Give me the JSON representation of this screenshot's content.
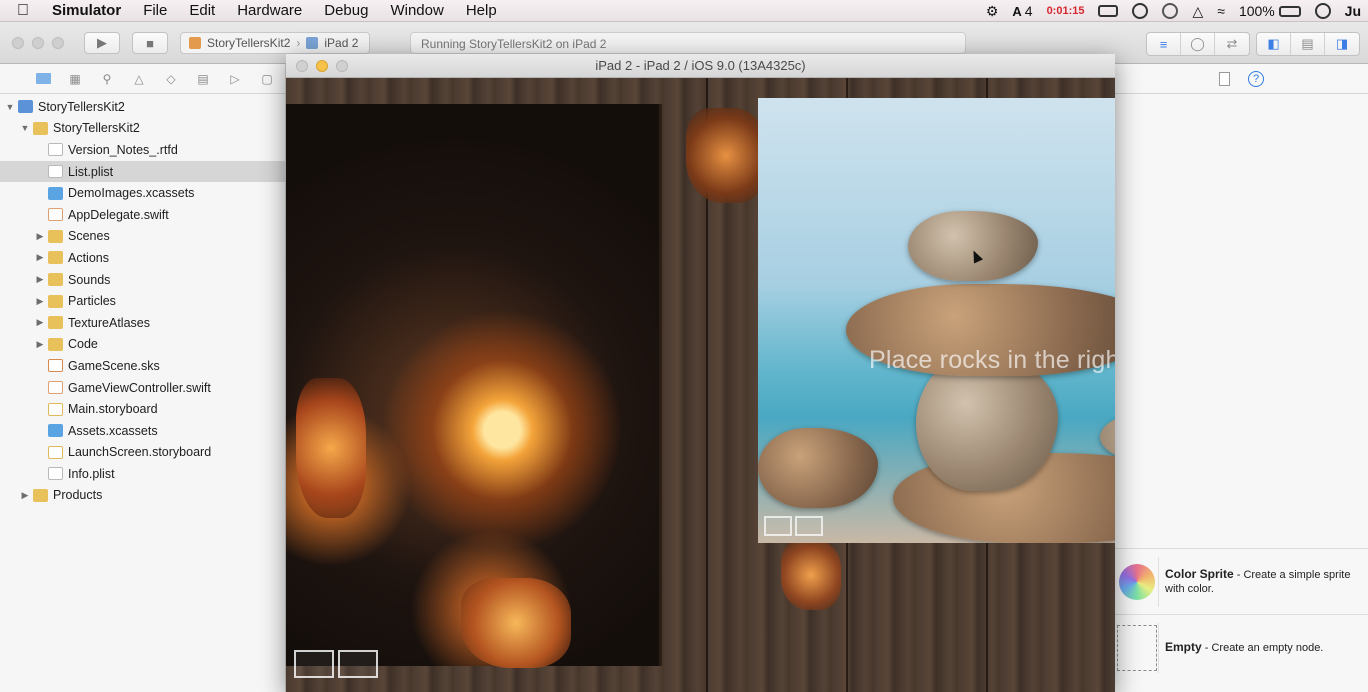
{
  "menubar": {
    "app": "Simulator",
    "items": [
      "File",
      "Edit",
      "Hardware",
      "Debug",
      "Window",
      "Help"
    ],
    "status": {
      "adobe_count": "4",
      "timer": "0:01:15",
      "battery": "100%",
      "user_initial": "Ju"
    }
  },
  "toolbar": {
    "scheme_project": "StoryTellersKit2",
    "scheme_device": "iPad 2",
    "activity": "Running StoryTellersKit2 on iPad 2"
  },
  "navigator": {
    "items": [
      {
        "label": "StoryTellersKit2",
        "icon": "project-icon",
        "indent": 0,
        "disclosure": "open"
      },
      {
        "label": "StoryTellersKit2",
        "icon": "folder-icon",
        "indent": 1,
        "disclosure": "open"
      },
      {
        "label": "Version_Notes_.rtfd",
        "icon": "document-icon",
        "indent": 2,
        "disclosure": "none"
      },
      {
        "label": "List.plist",
        "icon": "plist-icon",
        "indent": 2,
        "disclosure": "none",
        "selected": true
      },
      {
        "label": "DemoImages.xcassets",
        "icon": "asset-catalog-icon",
        "indent": 2,
        "disclosure": "none"
      },
      {
        "label": "AppDelegate.swift",
        "icon": "swift-file-icon",
        "indent": 2,
        "disclosure": "none"
      },
      {
        "label": "Scenes",
        "icon": "folder-icon",
        "indent": 2,
        "disclosure": "closed"
      },
      {
        "label": "Actions",
        "icon": "folder-icon",
        "indent": 2,
        "disclosure": "closed"
      },
      {
        "label": "Sounds",
        "icon": "folder-icon",
        "indent": 2,
        "disclosure": "closed"
      },
      {
        "label": "Particles",
        "icon": "folder-icon",
        "indent": 2,
        "disclosure": "closed"
      },
      {
        "label": "TextureAtlases",
        "icon": "folder-icon",
        "indent": 2,
        "disclosure": "closed"
      },
      {
        "label": "Code",
        "icon": "folder-icon",
        "indent": 2,
        "disclosure": "closed"
      },
      {
        "label": "GameScene.sks",
        "icon": "sks-file-icon",
        "indent": 2,
        "disclosure": "none"
      },
      {
        "label": "GameViewController.swift",
        "icon": "swift-file-icon",
        "indent": 2,
        "disclosure": "none"
      },
      {
        "label": "Main.storyboard",
        "icon": "storyboard-icon",
        "indent": 2,
        "disclosure": "none"
      },
      {
        "label": "Assets.xcassets",
        "icon": "asset-catalog-icon",
        "indent": 2,
        "disclosure": "none"
      },
      {
        "label": "LaunchScreen.storyboard",
        "icon": "storyboard-icon",
        "indent": 2,
        "disclosure": "none"
      },
      {
        "label": "Info.plist",
        "icon": "plist-icon",
        "indent": 2,
        "disclosure": "none"
      },
      {
        "label": "Products",
        "icon": "folder-icon",
        "indent": 1,
        "disclosure": "closed"
      }
    ]
  },
  "simulator": {
    "title": "iPad 2 - iPad 2 / iOS 9.0 (13A4325c)",
    "prompt": "Place    rocks in the right order..."
  },
  "library": {
    "items": [
      {
        "name": "Color Sprite",
        "desc": " - Create a simple sprite with color.",
        "icon": "color-swatch-icon"
      },
      {
        "name": "Empty",
        "desc": " - Create an empty node.",
        "icon": "empty-node-icon"
      }
    ]
  }
}
